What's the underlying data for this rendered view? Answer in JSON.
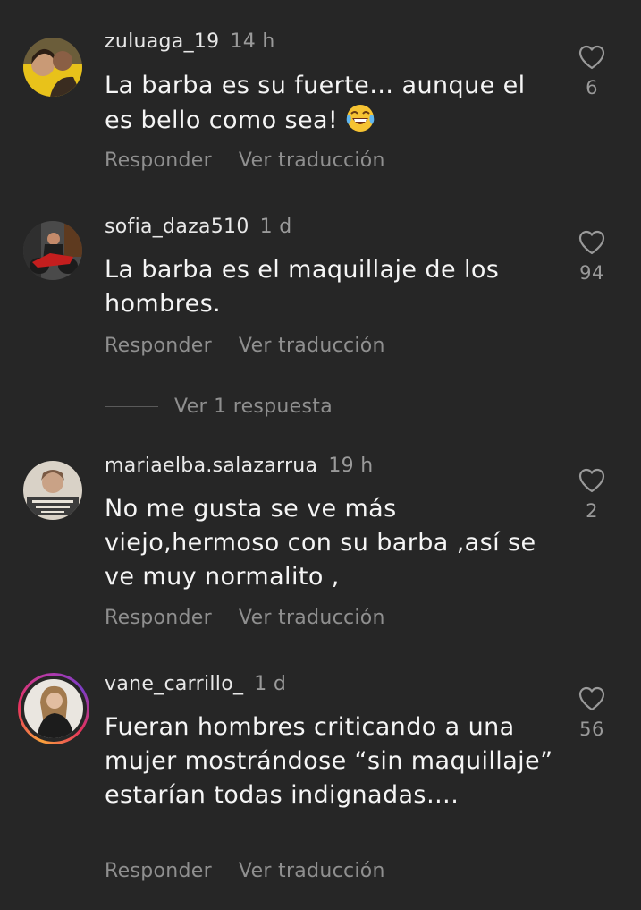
{
  "comments": [
    {
      "username": "zuluaga_19",
      "time": "14 h",
      "text": "La barba es su fuerte… aunque el es bello como sea!",
      "emoji": "😂",
      "likes": "6",
      "reply_label": "Responder",
      "translate_label": "Ver traducción"
    },
    {
      "username": "sofia_daza510",
      "time": "1 d",
      "text": "La barba es el maquillaje de los hombres.",
      "likes": "94",
      "reply_label": "Responder",
      "translate_label": "Ver traducción"
    },
    {
      "username": "mariaelba.salazarrua",
      "time": "19 h",
      "text": "No me gusta se ve más viejo,hermoso con su barba ,así se ve muy normalito ,",
      "likes": "2",
      "reply_label": "Responder",
      "translate_label": "Ver traducción"
    },
    {
      "username": "vane_carrillo_",
      "time": "1 d",
      "text": "Fueran hombres criticando a una mujer mostrándose “sin maquillaje” estarían todas indignadas….",
      "likes": "56",
      "reply_label": "Responder",
      "translate_label": "Ver traducción"
    }
  ],
  "view_replies": "Ver 1 respuesta",
  "icons": {
    "like": "heart-outline-icon",
    "emoji": "face-with-tears-of-joy"
  },
  "colors": {
    "background": "#262626",
    "text_primary": "#f5f5f5",
    "text_secondary": "#8f8f8f",
    "story_ring_start": "#f9a23c",
    "story_ring_end": "#b93aa8"
  }
}
